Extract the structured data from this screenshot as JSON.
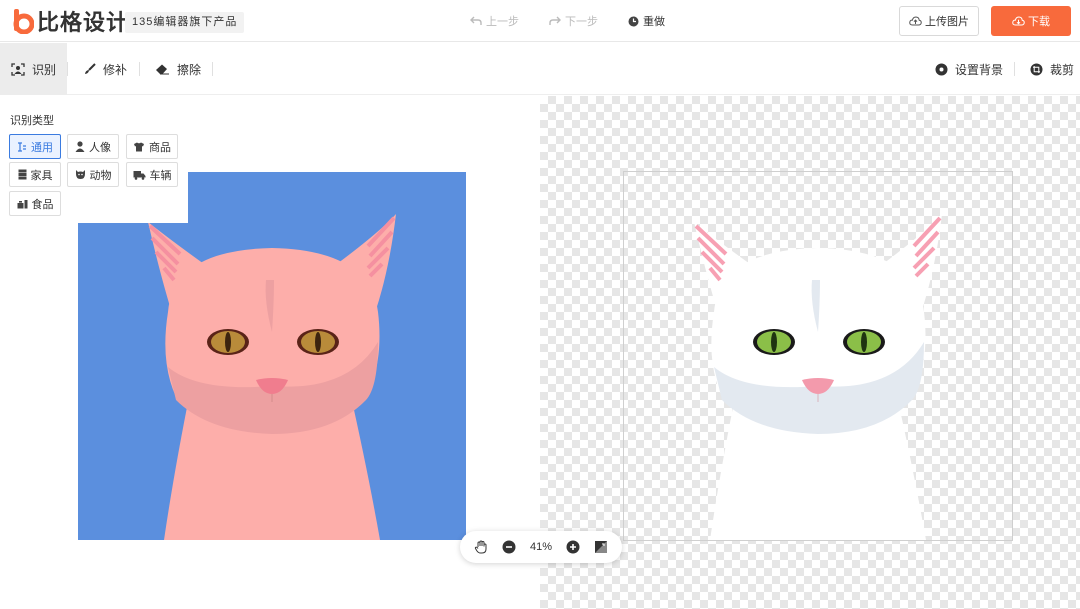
{
  "header": {
    "logo_text": "比格设计",
    "product_tag": "135编辑器旗下产品",
    "undo_label": "上一步",
    "redo_label": "下一步",
    "reset_label": "重做",
    "upload_label": "上传图片",
    "download_label": "下载"
  },
  "toolbar": {
    "recognize_label": "识别",
    "repair_label": "修补",
    "erase_label": "擦除",
    "background_label": "设置背景",
    "crop_label": "裁剪"
  },
  "panel": {
    "title": "识别类型",
    "types": [
      {
        "label": "通用",
        "icon": "general-icon",
        "selected": true
      },
      {
        "label": "人像",
        "icon": "person-icon",
        "selected": false
      },
      {
        "label": "商品",
        "icon": "product-icon",
        "selected": false
      },
      {
        "label": "家具",
        "icon": "furniture-icon",
        "selected": false
      },
      {
        "label": "动物",
        "icon": "animal-icon",
        "selected": false
      },
      {
        "label": "车辆",
        "icon": "vehicle-icon",
        "selected": false
      },
      {
        "label": "食品",
        "icon": "food-icon",
        "selected": false
      }
    ]
  },
  "zoom": {
    "level": "41%"
  },
  "colors": {
    "accent": "#f86a3c",
    "selected": "#3a7be0",
    "source_background": "#5b8fde",
    "cat_pink": "#fdaeaa",
    "cat_white": "#ffffff"
  }
}
